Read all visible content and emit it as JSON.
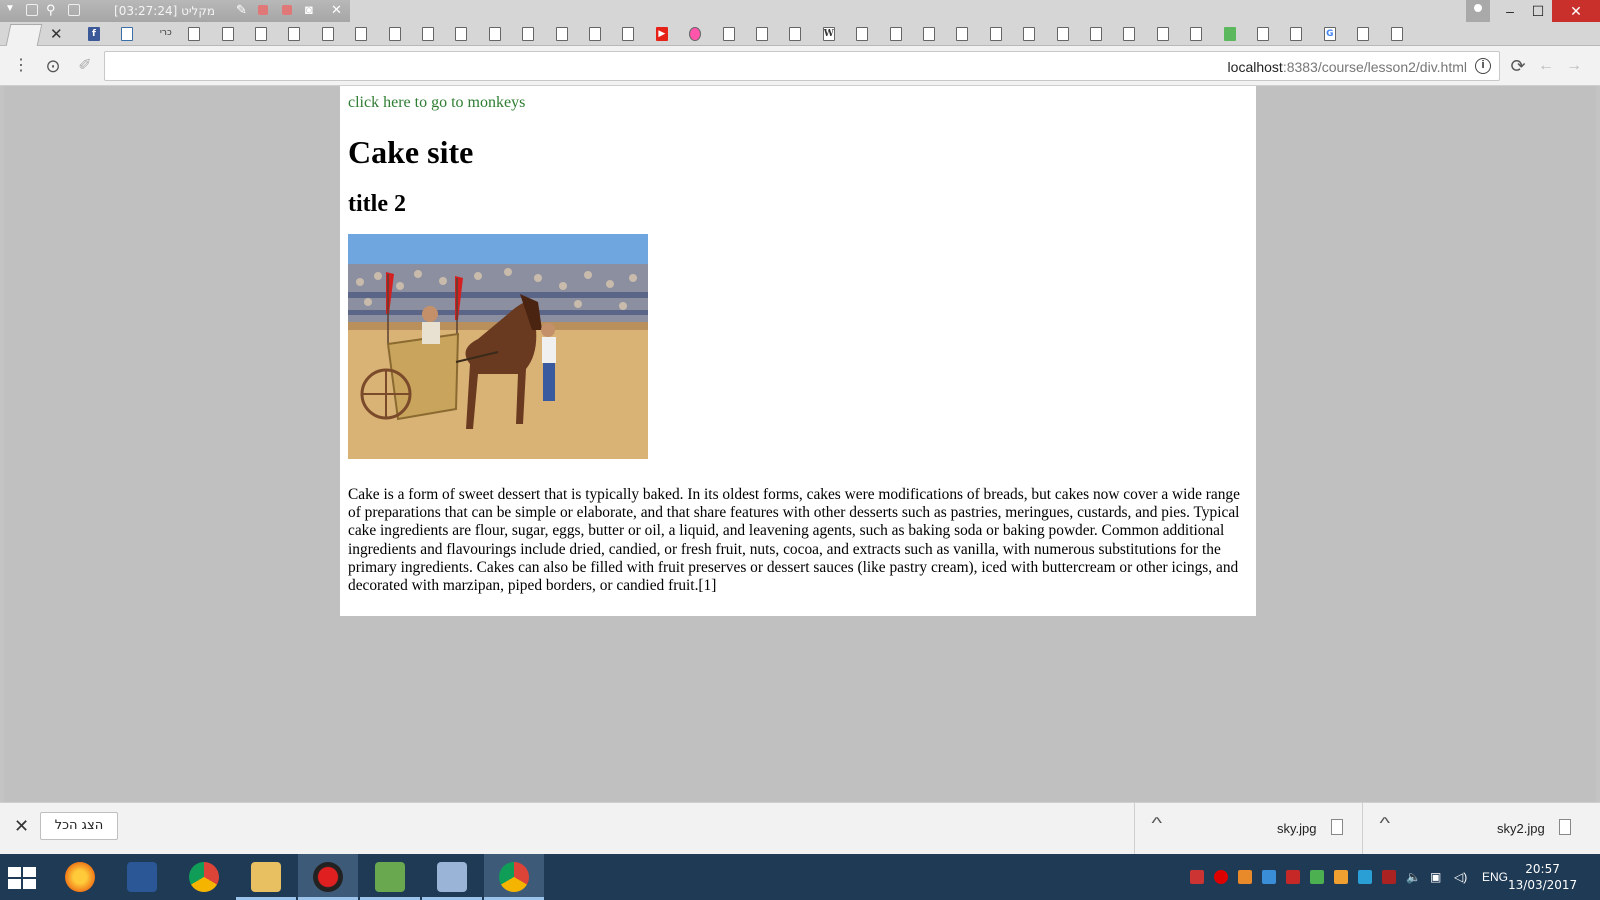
{
  "recorder": {
    "title": "מקליט [03:27:24]"
  },
  "tabs": {
    "active_close": "✕",
    "favicons": [
      "fb",
      "box",
      "כרי",
      "doc",
      "doc",
      "doc",
      "doc",
      "doc",
      "doc",
      "doc",
      "doc",
      "doc",
      "doc",
      "doc",
      "doc",
      "doc",
      "doc",
      "yt",
      "reddit",
      "doc",
      "doc",
      "doc",
      "W",
      "doc",
      "doc",
      "doc",
      "doc",
      "doc",
      "doc",
      "doc",
      "doc",
      "doc",
      "doc",
      "doc",
      "green",
      "doc",
      "doc",
      "G",
      "doc",
      "doc"
    ]
  },
  "window": {
    "minimize": "–",
    "maximize": "☐",
    "close": "✕"
  },
  "toolbar": {
    "menu_icon": "⋮",
    "url_host": "localhost",
    "url_rest": ":8383/course/lesson2/div.html",
    "info_icon": "i",
    "reload_icon": "⟳",
    "back_icon": "←",
    "forward_icon": "→",
    "star_icon": "☆"
  },
  "page": {
    "link": "click here to go to monkeys",
    "h1": "Cake site",
    "h2": "title 2",
    "paragraph": "Cake is a form of sweet dessert that is typically baked. In its oldest forms, cakes were modifications of breads, but cakes now cover a wide range of preparations that can be simple or elaborate, and that share features with other desserts such as pastries, meringues, custards, and pies. Typical cake ingredients are flour, sugar, eggs, butter or oil, a liquid, and leavening agents, such as baking soda or baking powder. Common additional ingredients and flavourings include dried, candied, or fresh fruit, nuts, cocoa, and extracts such as vanilla, with numerous substitutions for the primary ingredients. Cakes can also be filled with fruit preserves or dessert sauces (like pastry cream), iced with buttercream or other icings, and decorated with marzipan, piped borders, or candied fruit.[1]"
  },
  "downloads": {
    "close_icon": "✕",
    "show_all": "הצג הכל",
    "items": [
      {
        "name": "sky.jpg"
      },
      {
        "name": "sky2.jpg"
      }
    ]
  },
  "taskbar": {
    "language": "ENG",
    "time": "20:57",
    "date": "13/03/2017"
  }
}
